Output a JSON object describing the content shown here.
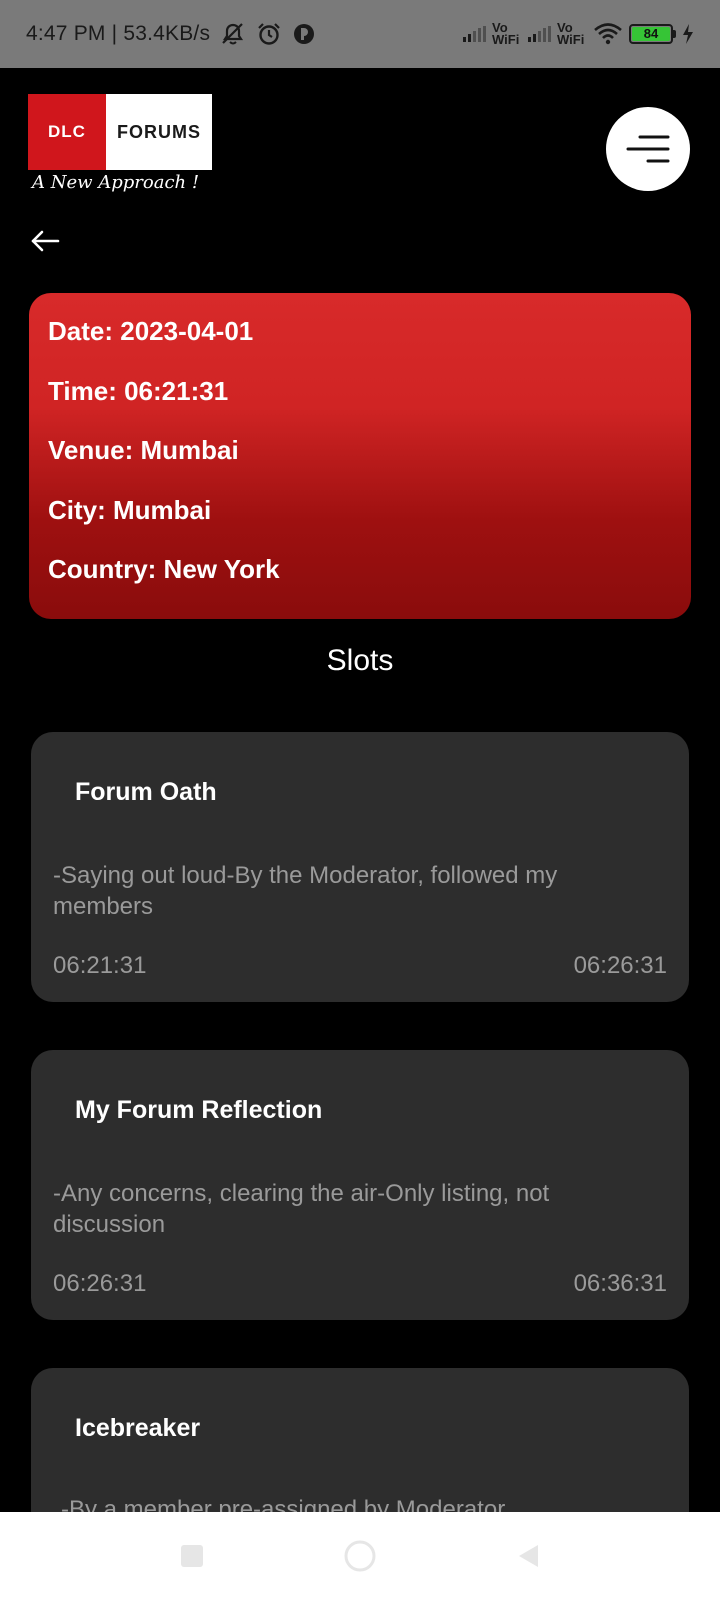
{
  "status_bar": {
    "time_speed": "4:47 PM | 53.4KB/s",
    "icons": [
      "muted-alarm-icon",
      "alarm-clock-icon",
      "app-notification-icon",
      "signal-icon",
      "vowifi-icon",
      "signal-icon",
      "vowifi-icon",
      "wifi-icon",
      "battery-icon",
      "charging-icon"
    ],
    "vowifi_1": "Vo WiFi",
    "vowifi_2": "Vo WiFi",
    "battery_level": "84",
    "battery_color": "#36c436"
  },
  "header": {
    "logo_left": "DLC",
    "logo_right": "FORUMS",
    "tagline": "A New Approach !",
    "menu_icon": "hamburger-menu-icon",
    "back_icon": "arrow-left-icon"
  },
  "event": {
    "date": "Date: 2023-04-01",
    "time": "Time: 06:21:31",
    "venue": "Venue: Mumbai",
    "city": "City: Mumbai",
    "country": "Country: New York",
    "accent": "#d32525"
  },
  "slots_title": "Slots",
  "slots": [
    {
      "title": "Forum Oath",
      "description": "-Saying out loud-By the Moderator, followed my members",
      "start": "06:21:31",
      "end": "06:26:31"
    },
    {
      "title": "My Forum Reflection",
      "description": "-Any concerns, clearing the air-Only listing, not discussion",
      "start": "06:26:31",
      "end": "06:36:31"
    },
    {
      "title": "Icebreaker",
      "description": "-By a member pre-assigned by Moderator"
    }
  ],
  "nav_bar": {
    "icons": [
      "recent-apps-icon",
      "home-icon",
      "back-icon"
    ]
  }
}
